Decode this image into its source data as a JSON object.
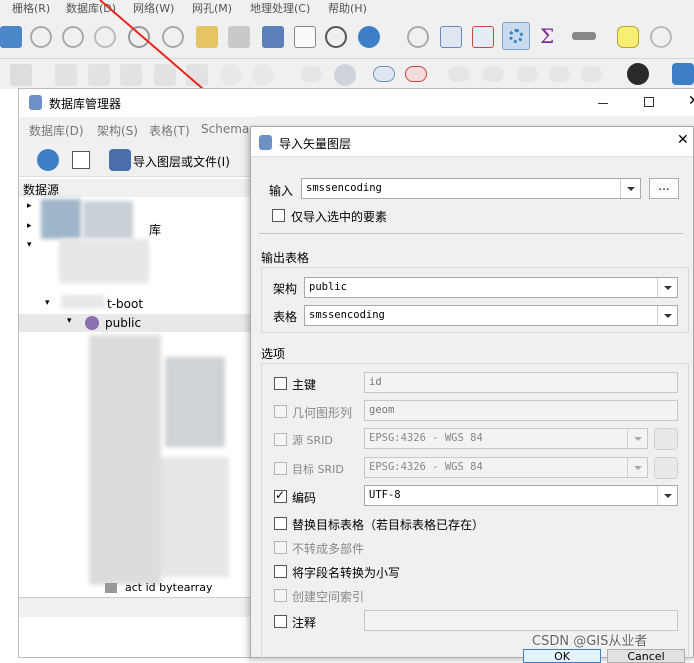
{
  "menu": [
    "栅格(R)",
    "数据库(D)",
    "网络(W)",
    "网孔(M)",
    "地理处理(C)",
    "帮助(H)"
  ],
  "db_manager": {
    "title": "数据库管理器",
    "menu": [
      "数据库(D)",
      "架构(S)",
      "表格(T)",
      "Schema"
    ],
    "import_button": "导入图层或文件(I)",
    "panel_header": "数据源",
    "tree": {
      "item_db": "库",
      "item_boot": "t-boot",
      "item_public": "public",
      "item_last": "act id  bytearray"
    }
  },
  "dialog": {
    "title": "导入矢量图层",
    "input_label": "输入",
    "input_value": "smssencoding",
    "browse": "...",
    "only_selected": "仅导入选中的要素",
    "output_section": "输出表格",
    "schema_label": "架构",
    "schema_value": "public",
    "table_label": "表格",
    "table_value": "smssencoding",
    "options_section": "选项",
    "options": {
      "primary_key": {
        "label": "主键",
        "value": "id"
      },
      "geometry_column": {
        "label": "几何图形列",
        "value": "geom"
      },
      "source_srid": {
        "label": "源 SRID",
        "value": "EPSG:4326 - WGS 84"
      },
      "target_srid": {
        "label": "目标 SRID",
        "value": "EPSG:4326 - WGS 84"
      },
      "encoding": {
        "label": "编码",
        "value": "UTF-8"
      },
      "replace": "替换目标表格（若目标表格已存在）",
      "no_multi": "不转成多部件",
      "lowercase": "将字段名转换为小写",
      "spatial_index": "创建空间索引",
      "comment": "注释"
    },
    "ok": "OK",
    "cancel": "Cancel"
  },
  "watermark": "CSDN @GIS从业者",
  "colors": {
    "annotation": "#e8261d",
    "accent": "#3c7fc6"
  }
}
